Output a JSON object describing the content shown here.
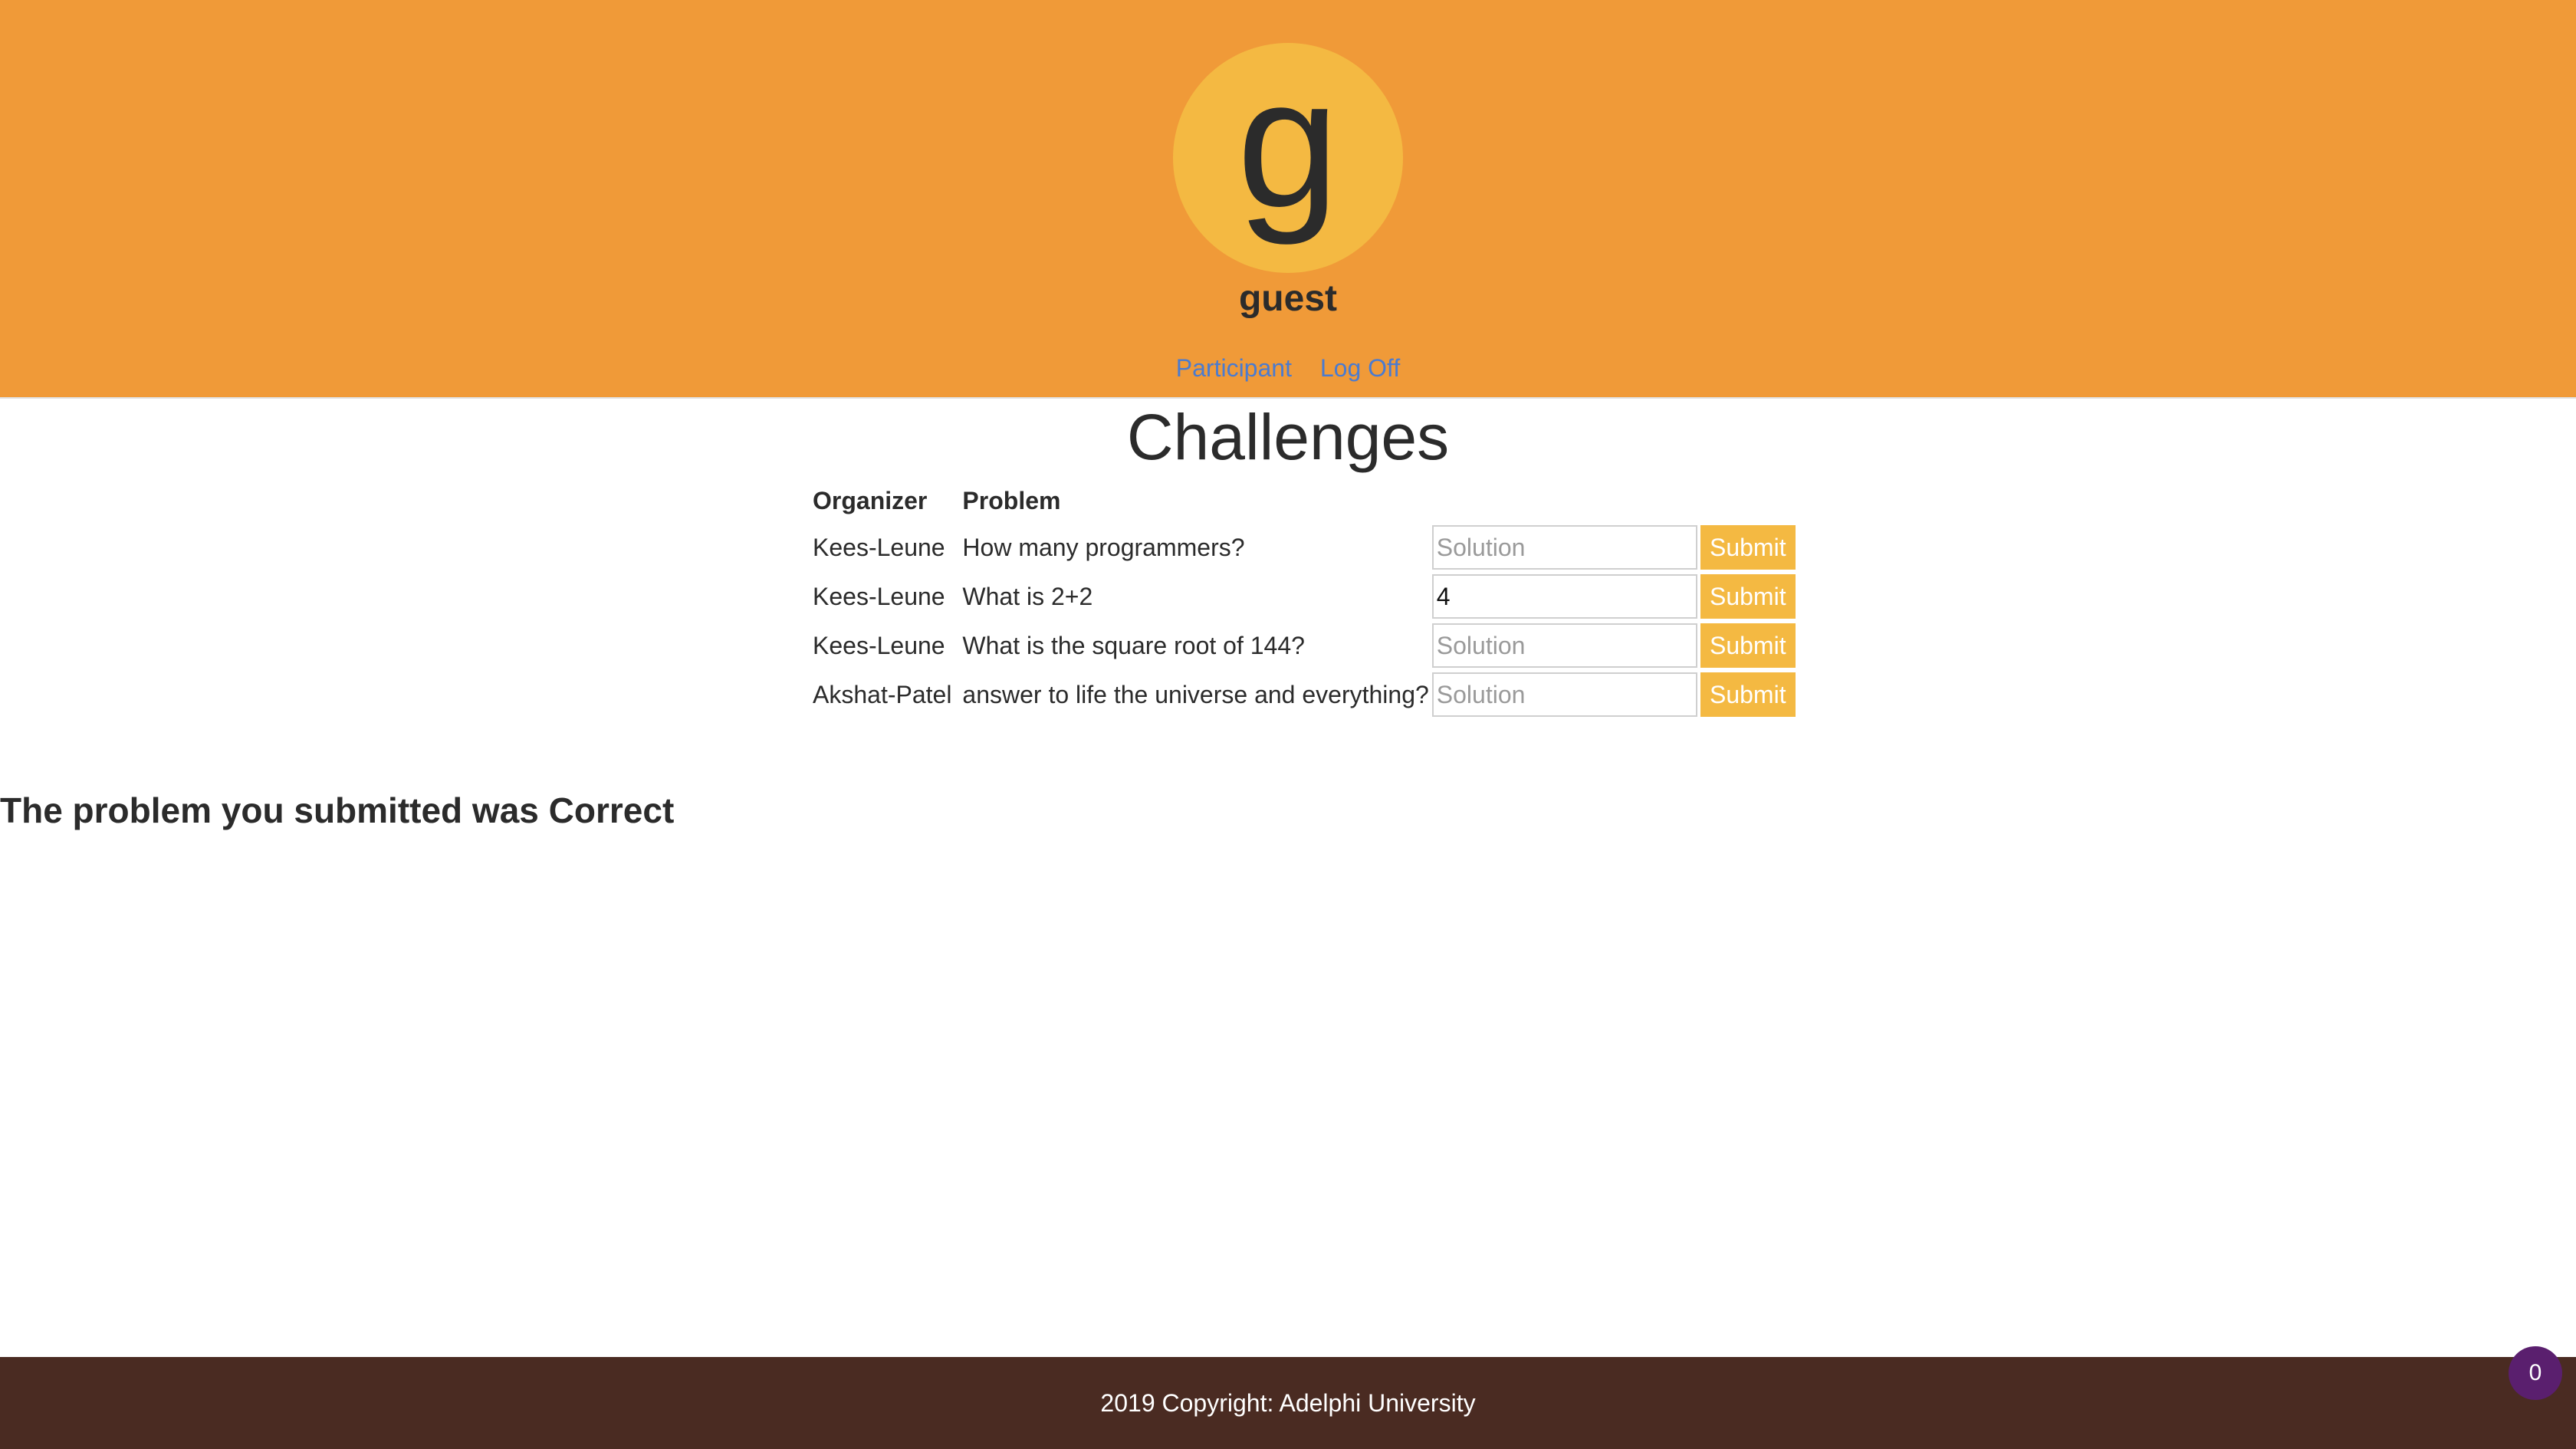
{
  "header": {
    "avatar_letter": "g",
    "username": "guest",
    "nav": [
      {
        "label": "Participant"
      },
      {
        "label": "Log Off"
      }
    ]
  },
  "main": {
    "title": "Challenges",
    "table": {
      "headers": [
        "Organizer",
        "Problem"
      ],
      "rows": [
        {
          "organizer": "Kees-Leune",
          "problem": "How many programmers?",
          "solution_value": "",
          "solution_placeholder": "Solution",
          "submit_label": "Submit"
        },
        {
          "organizer": "Kees-Leune",
          "problem": "What is 2+2",
          "solution_value": "4",
          "solution_placeholder": "Solution",
          "submit_label": "Submit"
        },
        {
          "organizer": "Kees-Leune",
          "problem": "What is the square root of 144?",
          "solution_value": "",
          "solution_placeholder": "Solution",
          "submit_label": "Submit"
        },
        {
          "organizer": "Akshat-Patel",
          "problem": "answer to life the universe and everything?",
          "solution_value": "",
          "solution_placeholder": "Solution",
          "submit_label": "Submit"
        }
      ]
    },
    "result_message": "The problem you submitted was Correct"
  },
  "footer": {
    "copyright": "2019 Copyright: Adelphi University"
  },
  "badge": {
    "count": "0"
  },
  "colors": {
    "header_bg": "#f09a38",
    "avatar_bg": "#f4b942",
    "button_bg": "#f4b942",
    "link": "#4a7bd0",
    "footer_bg": "#4a2b22",
    "badge_bg": "#5a1f6e"
  }
}
